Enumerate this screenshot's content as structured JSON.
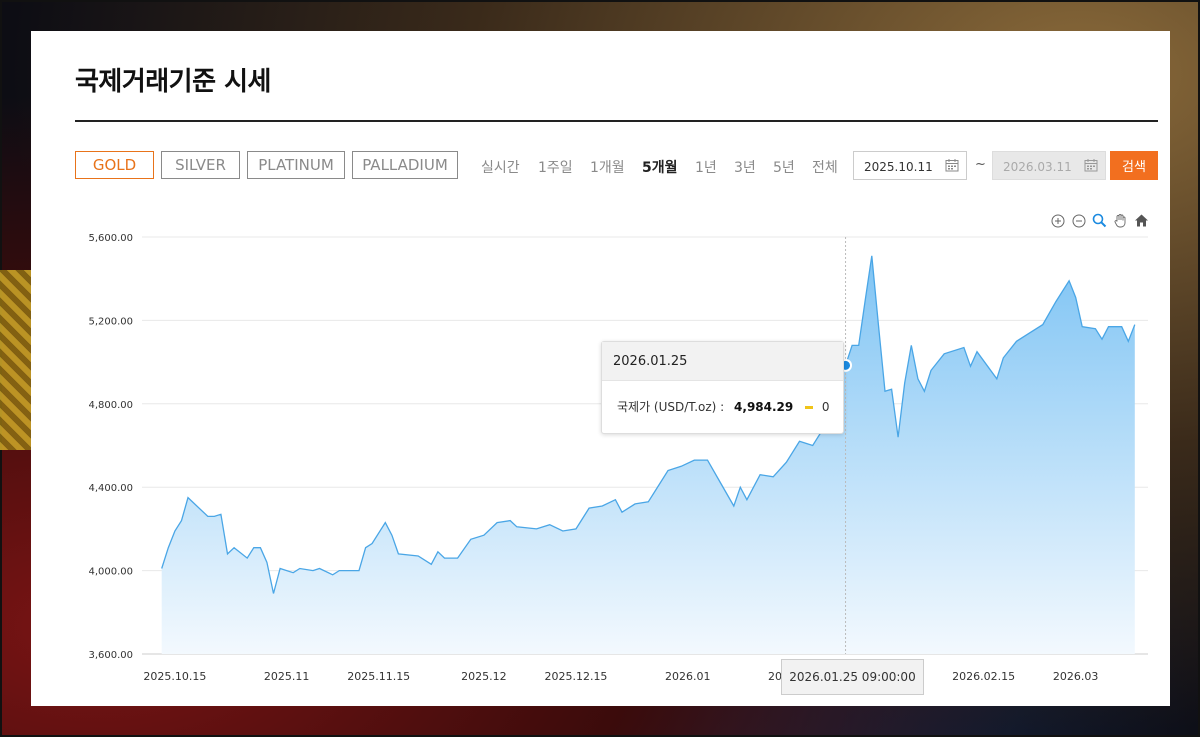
{
  "page": {
    "title": "국제거래기준 시세"
  },
  "metals": [
    {
      "label": "GOLD",
      "active": true
    },
    {
      "label": "SILVER",
      "active": false
    },
    {
      "label": "PLATINUM",
      "active": false
    },
    {
      "label": "PALLADIUM",
      "active": false
    }
  ],
  "periods": [
    {
      "label": "실시간",
      "active": false
    },
    {
      "label": "1주일",
      "active": false
    },
    {
      "label": "1개월",
      "active": false
    },
    {
      "label": "5개월",
      "active": true
    },
    {
      "label": "1년",
      "active": false
    },
    {
      "label": "3년",
      "active": false
    },
    {
      "label": "5년",
      "active": false
    },
    {
      "label": "전체",
      "active": false
    }
  ],
  "date_range": {
    "start": "2025.10.11",
    "separator": "~",
    "end": "2026.03.11",
    "search_label": "검색"
  },
  "tooltip": {
    "date": "2026.01.25",
    "series_label": "국제가 (USD/T.oz) :",
    "value": "4,984.29",
    "change": "0"
  },
  "x_crosshair_label": "2026.01.25 09:00:00",
  "colors": {
    "accent": "#f26f1f",
    "line": "#5aaee8",
    "area_top": "#8ecbf5",
    "marker": "#1b8ae0"
  },
  "chart_data": {
    "type": "area",
    "ylim": [
      3600,
      5600
    ],
    "y_ticks": [
      "5,600.00",
      "5,200.00",
      "4,800.00",
      "4,400.00",
      "4,000.00",
      "3,600.00"
    ],
    "x_ticks": [
      "2025.10.15",
      "2025.11",
      "2025.11.15",
      "2025.12",
      "2025.12.15",
      "2026.01",
      "2026",
      "2026.02.15",
      "2026.03"
    ],
    "grid": true,
    "series": [
      {
        "values": [
          [
            "2025.10.13",
            4010
          ],
          [
            "2025.10.14",
            4110
          ],
          [
            "2025.10.15",
            4190
          ],
          [
            "2025.10.16",
            4240
          ],
          [
            "2025.10.17",
            4350
          ],
          [
            "2025.10.20",
            4260
          ],
          [
            "2025.10.21",
            4260
          ],
          [
            "2025.10.22",
            4270
          ],
          [
            "2025.10.23",
            4080
          ],
          [
            "2025.10.24",
            4110
          ],
          [
            "2025.10.26",
            4060
          ],
          [
            "2025.10.27",
            4110
          ],
          [
            "2025.10.28",
            4110
          ],
          [
            "2025.10.29",
            4040
          ],
          [
            "2025.10.30",
            3890
          ],
          [
            "2025.10.31",
            4010
          ],
          [
            "2025.11.02",
            3990
          ],
          [
            "2025.11.03",
            4010
          ],
          [
            "2025.11.05",
            4000
          ],
          [
            "2025.11.06",
            4010
          ],
          [
            "2025.11.08",
            3980
          ],
          [
            "2025.11.09",
            4000
          ],
          [
            "2025.11.12",
            4000
          ],
          [
            "2025.11.13",
            4110
          ],
          [
            "2025.11.14",
            4130
          ],
          [
            "2025.11.16",
            4230
          ],
          [
            "2025.11.17",
            4170
          ],
          [
            "2025.11.18",
            4080
          ],
          [
            "2025.11.21",
            4070
          ],
          [
            "2025.11.23",
            4030
          ],
          [
            "2025.11.24",
            4090
          ],
          [
            "2025.11.25",
            4060
          ],
          [
            "2025.11.27",
            4060
          ],
          [
            "2025.11.29",
            4150
          ],
          [
            "2025.12.01",
            4170
          ],
          [
            "2025.12.03",
            4230
          ],
          [
            "2025.12.05",
            4240
          ],
          [
            "2025.12.06",
            4210
          ],
          [
            "2025.12.09",
            4200
          ],
          [
            "2025.12.11",
            4220
          ],
          [
            "2025.12.13",
            4190
          ],
          [
            "2025.12.15",
            4200
          ],
          [
            "2025.12.17",
            4300
          ],
          [
            "2025.12.19",
            4310
          ],
          [
            "2025.12.21",
            4340
          ],
          [
            "2025.12.22",
            4280
          ],
          [
            "2025.12.24",
            4320
          ],
          [
            "2025.12.26",
            4330
          ],
          [
            "2025.12.27",
            4380
          ],
          [
            "2025.12.29",
            4480
          ],
          [
            "2025.12.31",
            4500
          ],
          [
            "2026.01.02",
            4530
          ],
          [
            "2026.01.04",
            4530
          ],
          [
            "2026.01.06",
            4420
          ],
          [
            "2026.01.08",
            4310
          ],
          [
            "2026.01.09",
            4400
          ],
          [
            "2026.01.10",
            4340
          ],
          [
            "2026.01.12",
            4460
          ],
          [
            "2026.01.14",
            4450
          ],
          [
            "2026.01.16",
            4520
          ],
          [
            "2026.01.18",
            4620
          ],
          [
            "2026.01.19",
            4610
          ],
          [
            "2026.01.20",
            4600
          ],
          [
            "2026.01.22",
            4700
          ],
          [
            "2026.01.23",
            4800
          ],
          [
            "2026.01.25",
            4984.29
          ],
          [
            "2026.01.26",
            5080
          ],
          [
            "2026.01.27",
            5080
          ],
          [
            "2026.01.28",
            5300
          ],
          [
            "2026.01.29",
            5510
          ],
          [
            "2026.01.30",
            5180
          ],
          [
            "2026.01.31",
            4860
          ],
          [
            "2026.02.01",
            4870
          ],
          [
            "2026.02.02",
            4640
          ],
          [
            "2026.02.03",
            4900
          ],
          [
            "2026.02.04",
            5080
          ],
          [
            "2026.02.05",
            4920
          ],
          [
            "2026.02.06",
            4860
          ],
          [
            "2026.02.07",
            4960
          ],
          [
            "2026.02.09",
            5040
          ],
          [
            "2026.02.12",
            5070
          ],
          [
            "2026.02.13",
            4980
          ],
          [
            "2026.02.14",
            5050
          ],
          [
            "2026.02.17",
            4920
          ],
          [
            "2026.02.18",
            5020
          ],
          [
            "2026.02.20",
            5100
          ],
          [
            "2026.02.22",
            5140
          ],
          [
            "2026.02.24",
            5180
          ],
          [
            "2026.02.26",
            5290
          ],
          [
            "2026.02.28",
            5390
          ],
          [
            "2026.03.01",
            5310
          ],
          [
            "2026.03.02",
            5170
          ],
          [
            "2026.03.04",
            5160
          ],
          [
            "2026.03.05",
            5110
          ],
          [
            "2026.03.06",
            5170
          ],
          [
            "2026.03.08",
            5170
          ],
          [
            "2026.03.09",
            5100
          ],
          [
            "2026.03.10",
            5180
          ]
        ]
      }
    ]
  }
}
